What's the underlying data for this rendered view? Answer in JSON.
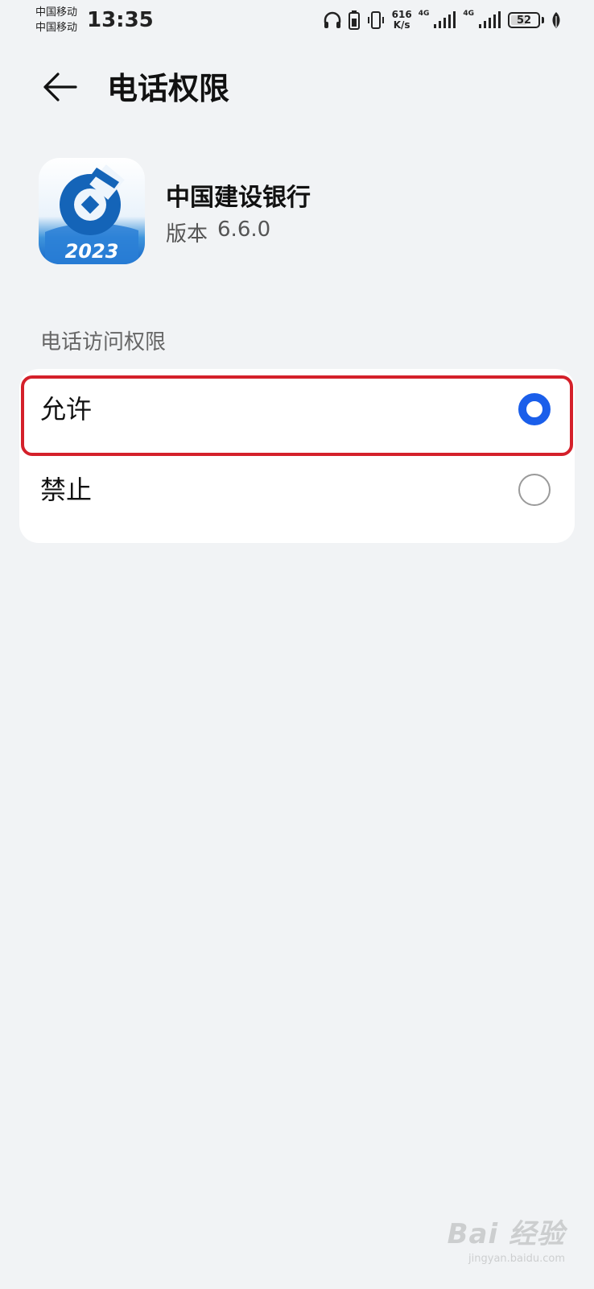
{
  "status_bar": {
    "carrier_1": "中国移动",
    "carrier_2": "中国移动",
    "time": "13:35",
    "net_speed_value": "616",
    "net_speed_unit": "K/s",
    "network_1": "4G",
    "network_2": "4G",
    "battery_level": "52",
    "icons": [
      "headphones-icon",
      "battery-saver-icon",
      "vibrate-icon",
      "signal-icon",
      "signal-icon",
      "battery-icon",
      "leaf-icon"
    ]
  },
  "header": {
    "back_icon": "arrow-left-icon",
    "title": "电话权限"
  },
  "app": {
    "name": "中国建设银行",
    "version_label": "版本",
    "version_value": "6.6.0",
    "icon_text": "2023",
    "icon": "ccb-app-icon"
  },
  "permission": {
    "section_title": "电话访问权限",
    "options": [
      {
        "label": "允许",
        "selected": true
      },
      {
        "label": "禁止",
        "selected": false
      }
    ]
  },
  "watermark": {
    "logo": "Bai 经验",
    "url": "jingyan.baidu.com"
  },
  "colors": {
    "background": "#f1f3f5",
    "card": "#ffffff",
    "accent": "#1a5eea",
    "highlight": "#d4202a"
  }
}
